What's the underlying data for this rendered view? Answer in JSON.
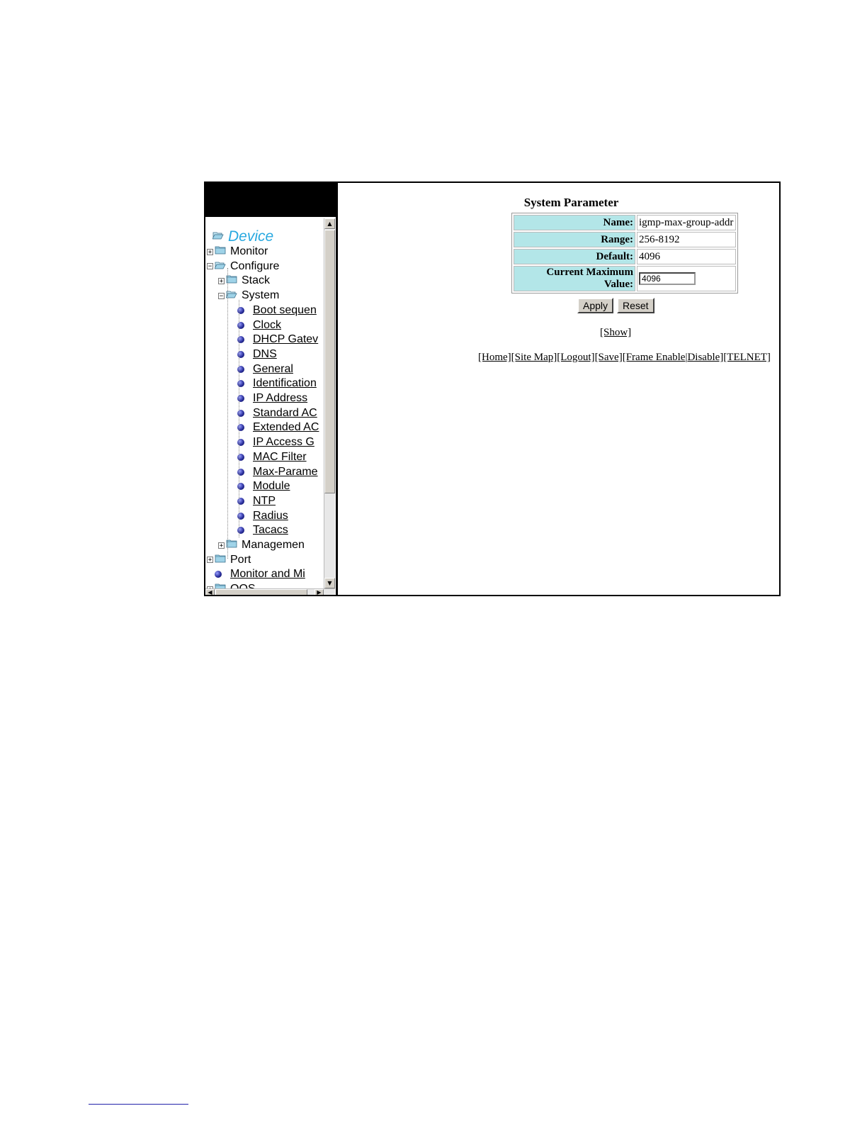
{
  "tree": {
    "root": "Device",
    "items": [
      {
        "label": "Monitor",
        "kind": "folder",
        "expander": "+"
      },
      {
        "label": "Configure",
        "kind": "folder-open",
        "expander": "-"
      },
      {
        "label": "Stack",
        "kind": "folder",
        "expander": "+"
      },
      {
        "label": "System",
        "kind": "folder-open",
        "expander": "-"
      },
      {
        "label": "Boot sequen",
        "kind": "link"
      },
      {
        "label": "Clock",
        "kind": "link"
      },
      {
        "label": "DHCP Gatev",
        "kind": "link"
      },
      {
        "label": "DNS",
        "kind": "link"
      },
      {
        "label": "General",
        "kind": "link"
      },
      {
        "label": "Identification",
        "kind": "link"
      },
      {
        "label": "IP Address",
        "kind": "link"
      },
      {
        "label": "Standard AC",
        "kind": "link"
      },
      {
        "label": "Extended AC",
        "kind": "link"
      },
      {
        "label": "IP Access G",
        "kind": "link"
      },
      {
        "label": "MAC Filter",
        "kind": "link"
      },
      {
        "label": "Max-Parame",
        "kind": "link"
      },
      {
        "label": "Module",
        "kind": "link"
      },
      {
        "label": "NTP",
        "kind": "link"
      },
      {
        "label": "Radius",
        "kind": "link"
      },
      {
        "label": "Tacacs",
        "kind": "link"
      },
      {
        "label": "Managemen",
        "kind": "folder",
        "expander": "+"
      },
      {
        "label": "Port",
        "kind": "folder",
        "expander": "+"
      },
      {
        "label": "Monitor and Mi",
        "kind": "link"
      },
      {
        "label": "QOS",
        "kind": "folder",
        "expander": "+"
      }
    ]
  },
  "form": {
    "title": "System Parameter",
    "rows": {
      "name_label": "Name:",
      "name_value": "igmp-max-group-addr",
      "range_label": "Range:",
      "range_value": "256-8192",
      "default_label": "Default:",
      "default_value": "4096",
      "current_label": "Current Maximum Value:",
      "current_value": "4096"
    },
    "apply_label": "Apply",
    "reset_label": "Reset",
    "show_link": "[Show]"
  },
  "nav": {
    "home": "[Home]",
    "site_map": "[Site Map]",
    "logout": "[Logout]",
    "save": "[Save]",
    "frame_enable": "[Frame Enable",
    "sep": "|",
    "disable": "Disable]",
    "telnet": "[TELNET]"
  },
  "colors": {
    "label_bg": "#b3e6e8",
    "device_text": "#29a9e0",
    "banner": "#000000"
  }
}
